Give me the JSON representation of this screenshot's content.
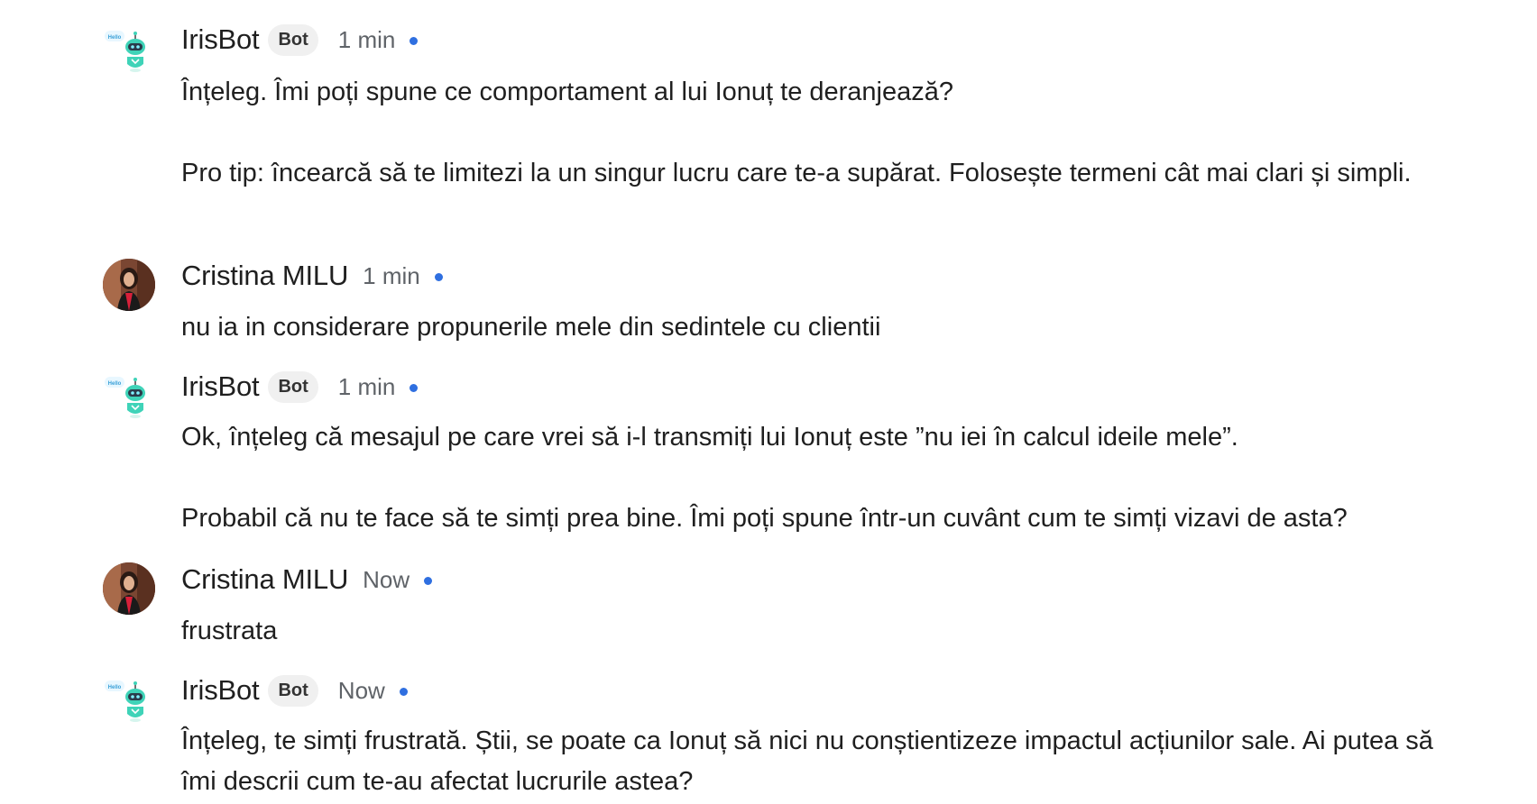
{
  "messages": [
    {
      "author": "IrisBot",
      "badge": "Bot",
      "time": "1 min",
      "paragraph1": "Înțeleg. Îmi poți spune ce comportament al lui Ionuț te deranjează?",
      "paragraph2": "Pro tip: încearcă să te limitezi la un singur lucru care te-a supărat. Folosește termeni cât mai clari și simpli."
    },
    {
      "author": "Cristina MILU",
      "time": "1 min",
      "paragraph1": "nu ia in considerare propunerile mele din sedintele cu clientii"
    },
    {
      "author": "IrisBot",
      "badge": "Bot",
      "time": "1 min",
      "paragraph1": "Ok, înțeleg că mesajul pe care vrei să i-l transmiți lui Ionuț este ”nu iei în calcul ideile mele”.",
      "paragraph2": "Probabil că nu te face să te simți prea bine. Îmi poți spune într-un cuvânt cum te simți vizavi de asta?"
    },
    {
      "author": "Cristina MILU",
      "time": "Now",
      "paragraph1": "frustrata"
    },
    {
      "author": "IrisBot",
      "badge": "Bot",
      "time": "Now",
      "paragraph1": "Înțeleg, te simți frustrată. Știi, se poate ca Ionuț să nici nu conștientizeze impactul acțiunilor sale. Ai putea să îmi descrii cum te-au afectat lucrurile astea?"
    }
  ],
  "bot_avatar_text": "Hello",
  "colors": {
    "status_dot": "#2f6fe0",
    "badge_bg": "#f0f0f0",
    "bot_teal": "#3fd3b8"
  }
}
